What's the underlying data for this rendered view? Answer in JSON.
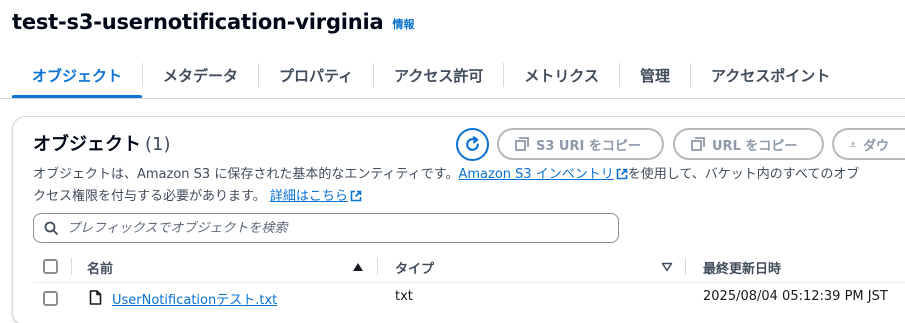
{
  "bucket": {
    "name": "test-s3-usernotification-virginia",
    "info_label": "情報"
  },
  "tabs": [
    {
      "label": "オブジェクト",
      "active": true
    },
    {
      "label": "メタデータ"
    },
    {
      "label": "プロパティ"
    },
    {
      "label": "アクセス許可"
    },
    {
      "label": "メトリクス"
    },
    {
      "label": "管理"
    },
    {
      "label": "アクセスポイント"
    }
  ],
  "objects_panel": {
    "title": "オブジェクト",
    "count": "(1)",
    "buttons": {
      "copy_s3_uri": "S3 URI をコピー",
      "copy_url": "URL をコピー",
      "download": "ダウ"
    },
    "description": {
      "part1": "オブジェクトは、Amazon S3 に保存された基本的なエンティティです。",
      "inventory_link": "Amazon S3 インベントリ",
      "part2": "を使用して、バケット内のすべてのオブ",
      "line2": "クセス権限を付与する必要があります。",
      "learn_more_link": "詳細はこちら"
    },
    "search": {
      "placeholder": "プレフィックスでオブジェクトを検索"
    },
    "table": {
      "columns": [
        "名前",
        "タイプ",
        "最終更新日時"
      ],
      "rows": [
        {
          "name": "UserNotificationテスト.txt",
          "type": "txt",
          "last_modified": "2025/08/04 05:12:39 PM JST"
        }
      ]
    }
  },
  "colors": {
    "accent": "#0972d3",
    "text": "#16191f",
    "border": "#d5dbdb",
    "disabled": "#8d99a8"
  }
}
